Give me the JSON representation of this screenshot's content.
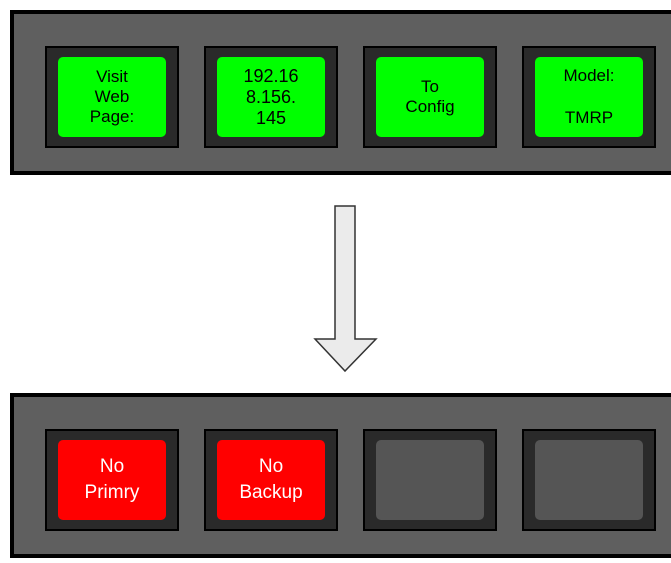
{
  "top_panel": {
    "keys": [
      {
        "lines": [
          "Visit",
          "Web",
          "Page:"
        ],
        "color": "#00ff00"
      },
      {
        "lines": [
          "192.16",
          "8.156.",
          "145"
        ],
        "color": "#00ff00"
      },
      {
        "lines": [
          "To",
          "Config"
        ],
        "color": "#00ff00"
      },
      {
        "lines": [
          "Model:",
          "TMRP"
        ],
        "color": "#00ff00"
      }
    ]
  },
  "bottom_panel": {
    "keys": [
      {
        "lines": [
          "No",
          "Primry"
        ],
        "color": "#ff0000"
      },
      {
        "lines": [
          "No",
          "Backup"
        ],
        "color": "#ff0000"
      },
      {
        "lines": [],
        "color": "#555555"
      },
      {
        "lines": [],
        "color": "#555555"
      }
    ]
  },
  "colors": {
    "panel": "#5f5f5f",
    "key_bezel": "#2a2a2a",
    "active_green": "#00ff00",
    "alarm_red": "#ff0000",
    "inactive_gray": "#555555",
    "arrow_fill": "#ebebeb"
  }
}
